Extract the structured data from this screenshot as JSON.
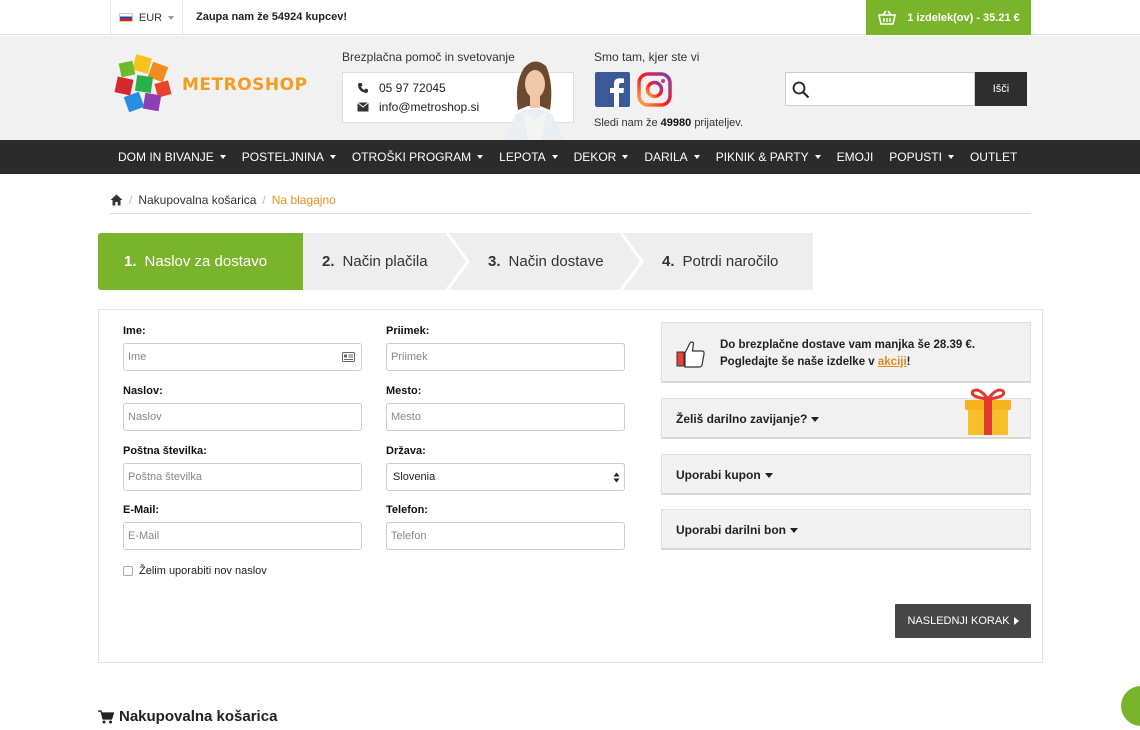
{
  "topbar": {
    "currency": "EUR",
    "trust_text": "Zaupa nam že 54924 kupcev!",
    "cart_label": "1 izdelek(ov) - 35.21 €"
  },
  "header": {
    "logo_text": "METROSHOP",
    "help_title": "Brezplačna pomoč in svetovanje",
    "phone": "05 97 72045",
    "email": "info@metroshop.si",
    "social_title": "Smo tam, kjer ste vi",
    "follow_prefix": "Sledi nam že",
    "follow_count": "49980",
    "follow_suffix": "prijateljev.",
    "search_button": "Išči"
  },
  "nav": {
    "items": [
      {
        "label": "DOM IN BIVANJE"
      },
      {
        "label": "POSTELJNINA"
      },
      {
        "label": "OTROŠKI PROGRAM"
      },
      {
        "label": "LEPOTA"
      },
      {
        "label": "DEKOR"
      },
      {
        "label": "DARILA"
      },
      {
        "label": "PIKNIK & PARTY"
      },
      {
        "label": "EMOJI"
      },
      {
        "label": "POPUSTI"
      },
      {
        "label": "OUTLET"
      }
    ]
  },
  "breadcrumb": {
    "cart": "Nakupovalna košarica",
    "current": "Na blagajno"
  },
  "steps": [
    {
      "num": "1.",
      "label": "Naslov za dostavo"
    },
    {
      "num": "2.",
      "label": "Način plačila"
    },
    {
      "num": "3.",
      "label": "Način dostave"
    },
    {
      "num": "4.",
      "label": "Potrdi naročilo"
    }
  ],
  "form": {
    "first_name": {
      "label": "Ime:",
      "placeholder": "Ime"
    },
    "last_name": {
      "label": "Priimek:",
      "placeholder": "Priimek"
    },
    "address": {
      "label": "Naslov:",
      "placeholder": "Naslov"
    },
    "city": {
      "label": "Mesto:",
      "placeholder": "Mesto"
    },
    "postal": {
      "label": "Poštna številka:",
      "placeholder": "Poštna številka"
    },
    "country": {
      "label": "Država:",
      "value": "Slovenia"
    },
    "email": {
      "label": "E-Mail:",
      "placeholder": "E-Mail"
    },
    "phone": {
      "label": "Telefon:",
      "placeholder": "Telefon"
    },
    "new_address": "Želim uporabiti nov naslov"
  },
  "sidebar": {
    "shipping_text": "Do brezplačne dostave vam manjka še 28.39 €. Pogledajte še naše izdelke v",
    "shipping_link": "akciji",
    "shipping_end": "!",
    "gift_wrap": "Želiš darilno zavijanje?",
    "coupon": "Uporabi kupon",
    "gift_card": "Uporabi darilni bon"
  },
  "next_button": "NASLEDNJI KORAK",
  "cart_heading": "Nakupovalna košarica"
}
